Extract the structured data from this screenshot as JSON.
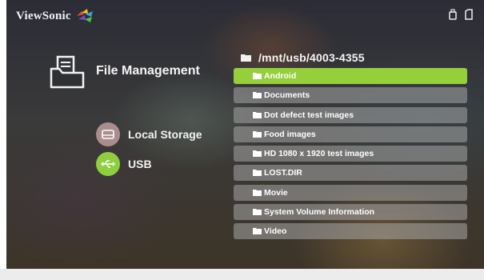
{
  "brand": {
    "name": "ViewSonic"
  },
  "status_icons": [
    "usb-drive-icon",
    "sd-card-icon"
  ],
  "app": {
    "title": "File Management",
    "icon": "folder-file-icon"
  },
  "storage": [
    {
      "label": "Local Storage",
      "icon": "hard-disk-icon",
      "color": "#ab8d8d"
    },
    {
      "label": "USB",
      "icon": "usb-icon",
      "color": "#8fcf3f"
    }
  ],
  "current_path": "/mnt/usb/4003-4355",
  "folders": [
    {
      "label": "Android",
      "selected": true
    },
    {
      "label": "Documents",
      "selected": false
    },
    {
      "label": "Dot defect test images",
      "selected": false
    },
    {
      "label": "Food images",
      "selected": false
    },
    {
      "label": "HD 1080 x 1920 test images",
      "selected": false
    },
    {
      "label": "LOST.DIR",
      "selected": false
    },
    {
      "label": "Movie",
      "selected": false
    },
    {
      "label": "System Volume Information",
      "selected": false
    },
    {
      "label": "Video",
      "selected": false
    }
  ],
  "colors": {
    "accent": "#95cf3a",
    "row": "#a5a5a5"
  }
}
